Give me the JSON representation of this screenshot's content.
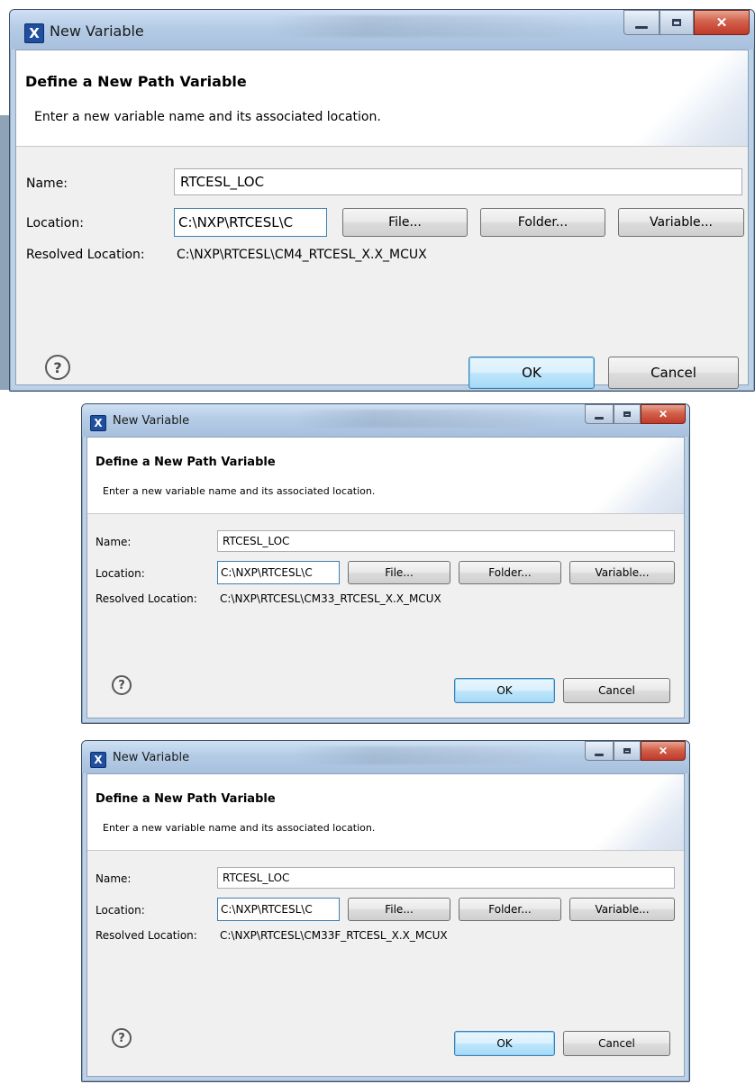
{
  "dialogs": [
    {
      "window_title": "New Variable",
      "header_title": "Define a New Path Variable",
      "header_description": "Enter a new variable name and its associated location.",
      "name_label": "Name:",
      "name_value": "RTCESL_LOC",
      "location_label": "Location:",
      "location_value": "C:\\NXP\\RTCESL\\C",
      "file_button": "File...",
      "folder_button": "Folder...",
      "variable_button": "Variable...",
      "resolved_label": "Resolved Location:",
      "resolved_value": "C:\\NXP\\RTCESL\\CM4_RTCESL_X.X_MCUX",
      "ok_button": "OK",
      "cancel_button": "Cancel",
      "help_icon": "?"
    },
    {
      "window_title": "New Variable",
      "header_title": "Define a New Path Variable",
      "header_description": "Enter a new variable name and its associated location.",
      "name_label": "Name:",
      "name_value": "RTCESL_LOC",
      "location_label": "Location:",
      "location_value": "C:\\NXP\\RTCESL\\C",
      "file_button": "File...",
      "folder_button": "Folder...",
      "variable_button": "Variable...",
      "resolved_label": "Resolved Location:",
      "resolved_value": "C:\\NXP\\RTCESL\\CM33_RTCESL_X.X_MCUX",
      "ok_button": "OK",
      "cancel_button": "Cancel",
      "help_icon": "?"
    },
    {
      "window_title": "New Variable",
      "header_title": "Define a New Path Variable",
      "header_description": "Enter a new variable name and its associated location.",
      "name_label": "Name:",
      "name_value": "RTCESL_LOC",
      "location_label": "Location:",
      "location_value": "C:\\NXP\\RTCESL\\C",
      "file_button": "File...",
      "folder_button": "Folder...",
      "variable_button": "Variable...",
      "resolved_label": "Resolved Location:",
      "resolved_value": "C:\\NXP\\RTCESL\\CM33F_RTCESL_X.X_MCUX",
      "ok_button": "OK",
      "cancel_button": "Cancel",
      "help_icon": "?"
    }
  ]
}
